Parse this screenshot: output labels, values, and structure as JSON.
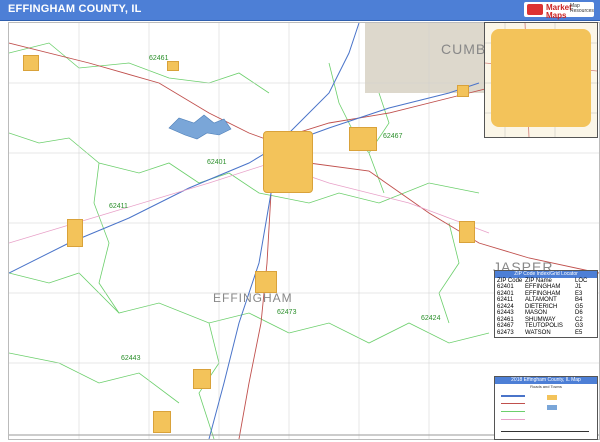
{
  "title": "EFFINGHAM COUNTY, IL",
  "logo": {
    "brand": "Market Maps",
    "sub": "Map Resources"
  },
  "neighbors": [
    {
      "label": "CUMBE"
    },
    {
      "label": "JASPER"
    }
  ],
  "county_label": "EFFINGHAM",
  "zip_labels": [
    "62461",
    "62467",
    "62401",
    "62411",
    "62473",
    "62424",
    "62443"
  ],
  "legend": {
    "header": "ZIP Code Index/Grid Locator",
    "columns": [
      "ZIP Code",
      "ZIP Name",
      "LOC"
    ],
    "rows": [
      [
        "62401",
        "EFFINGHAM",
        "J1"
      ],
      [
        "62401",
        "EFFINGHAM",
        "E3"
      ],
      [
        "62411",
        "ALTAMONT",
        "B4"
      ],
      [
        "62424",
        "DIETERICH",
        "G5"
      ],
      [
        "62443",
        "MASON",
        "D6"
      ],
      [
        "62461",
        "SHUMWAY",
        "C2"
      ],
      [
        "62467",
        "TEUTOPOLIS",
        "G3"
      ],
      [
        "62473",
        "WATSON",
        "E5"
      ]
    ]
  },
  "map_key": {
    "header": "2018 Effingham County, IL Map",
    "sub": "Roads and Towns"
  },
  "colors": {
    "title_bar": "#4d7fd6",
    "town_fill": "#f3c35a",
    "zip_boundary": "#6ccf6c",
    "highway_red": "#c0504d",
    "interstate_blue": "#4a74c9",
    "water": "#7aa6d8",
    "neighbor_fill": "#ddd8cc"
  }
}
